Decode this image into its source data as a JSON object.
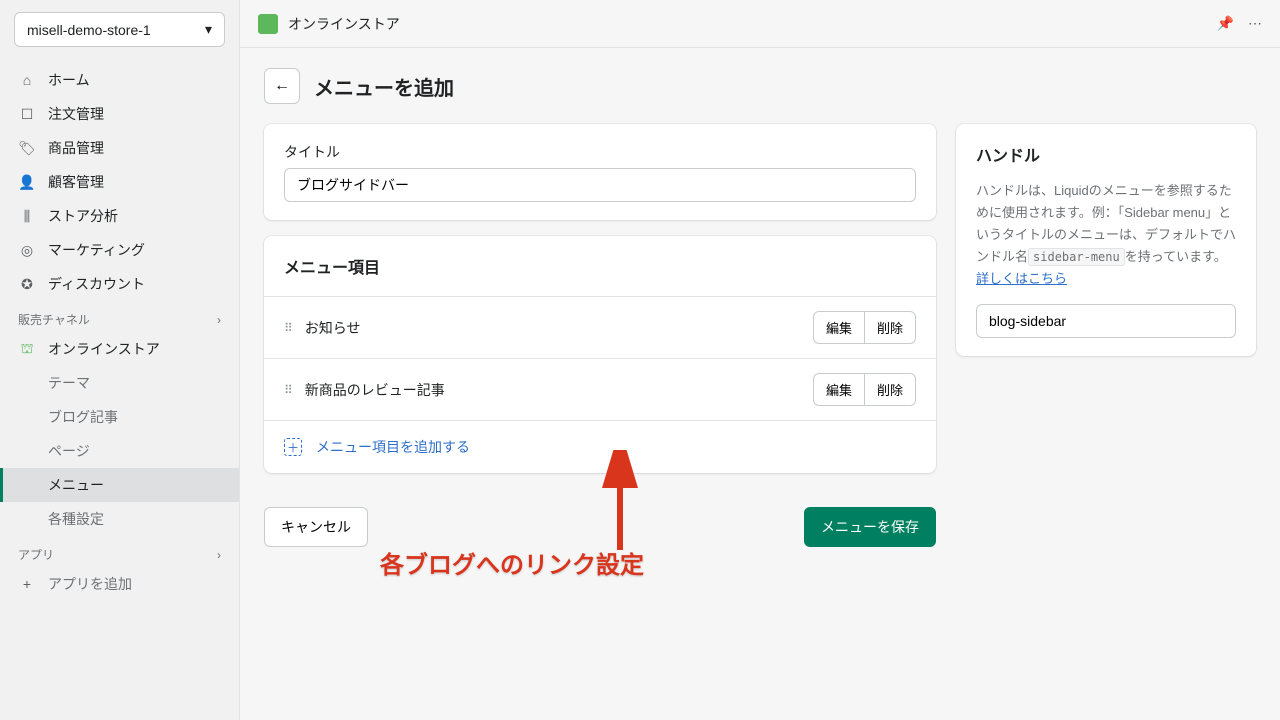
{
  "store": {
    "name": "misell-demo-store-1"
  },
  "topbar": {
    "title": "オンラインストア"
  },
  "nav": {
    "home": "ホーム",
    "orders": "注文管理",
    "products": "商品管理",
    "customers": "顧客管理",
    "analytics": "ストア分析",
    "marketing": "マーケティング",
    "discounts": "ディスカウント",
    "channels_label": "販売チャネル",
    "online_store": "オンラインストア",
    "sub": {
      "themes": "テーマ",
      "blogs": "ブログ記事",
      "pages": "ページ",
      "menus": "メニュー",
      "preferences": "各種設定"
    },
    "apps_label": "アプリ",
    "add_app": "アプリを追加"
  },
  "page": {
    "title": "メニューを追加",
    "title_label": "タイトル",
    "title_value": "ブログサイドバー",
    "menu_items_label": "メニュー項目",
    "items": [
      {
        "label": "お知らせ",
        "edit": "編集",
        "delete": "削除"
      },
      {
        "label": "新商品のレビュー記事",
        "edit": "編集",
        "delete": "削除"
      }
    ],
    "add_item": "メニュー項目を追加する",
    "cancel": "キャンセル",
    "save": "メニューを保存"
  },
  "handle": {
    "title": "ハンドル",
    "desc1": "ハンドルは、Liquidのメニューを参照するために使用されます。例：「Sidebar menu」というタイトルのメニューは、デフォルトでハンドル名",
    "code": "sidebar-menu",
    "desc2": "を持っています。",
    "link": "詳しくはこちら",
    "value": "blog-sidebar"
  },
  "annotation": "各ブログへのリンク設定"
}
